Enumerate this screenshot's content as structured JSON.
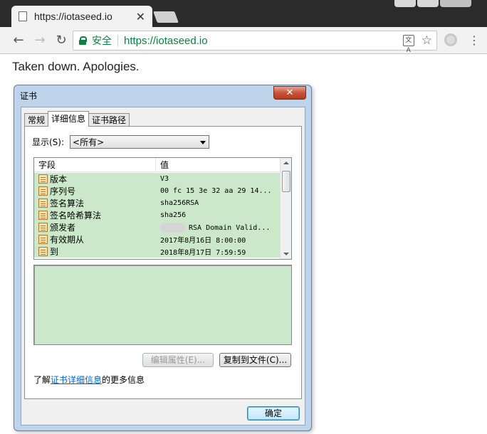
{
  "browser": {
    "tab_title": "https://iotaseed.io",
    "tab_close": "✕",
    "security_label": "安全",
    "url": "https://iotaseed.io",
    "translate_icon_text": "文A",
    "nav": {
      "back": "←",
      "forward": "→",
      "reload": "↻"
    },
    "menu": "⋮",
    "star": "☆"
  },
  "page": {
    "message": "Taken down. Apologies."
  },
  "dialog": {
    "title": "证书",
    "close": "✕",
    "tabs": [
      "常规",
      "详细信息",
      "证书路径"
    ],
    "active_tab": 1,
    "show_label": "显示(S):",
    "show_value": "<所有>",
    "columns": {
      "field": "字段",
      "value": "值"
    },
    "rows": [
      {
        "field": "版本",
        "value": "V3"
      },
      {
        "field": "序列号",
        "value": "00 fc 15 3e 32 aa 29 14..."
      },
      {
        "field": "签名算法",
        "value": "sha256RSA"
      },
      {
        "field": "签名哈希算法",
        "value": "sha256"
      },
      {
        "field": "颁发者",
        "value": "RSA Domain Valid..."
      },
      {
        "field": "有效期从",
        "value": "2017年8月16日 8:00:00"
      },
      {
        "field": "到",
        "value": "2018年8月17日 7:59:59"
      }
    ],
    "edit_button": "编辑属性(E)...",
    "copy_button": "复制到文件(C)...",
    "learn_prefix": "了解",
    "learn_link": "证书详细信息",
    "learn_suffix": "的更多信息",
    "ok_button": "确定"
  }
}
